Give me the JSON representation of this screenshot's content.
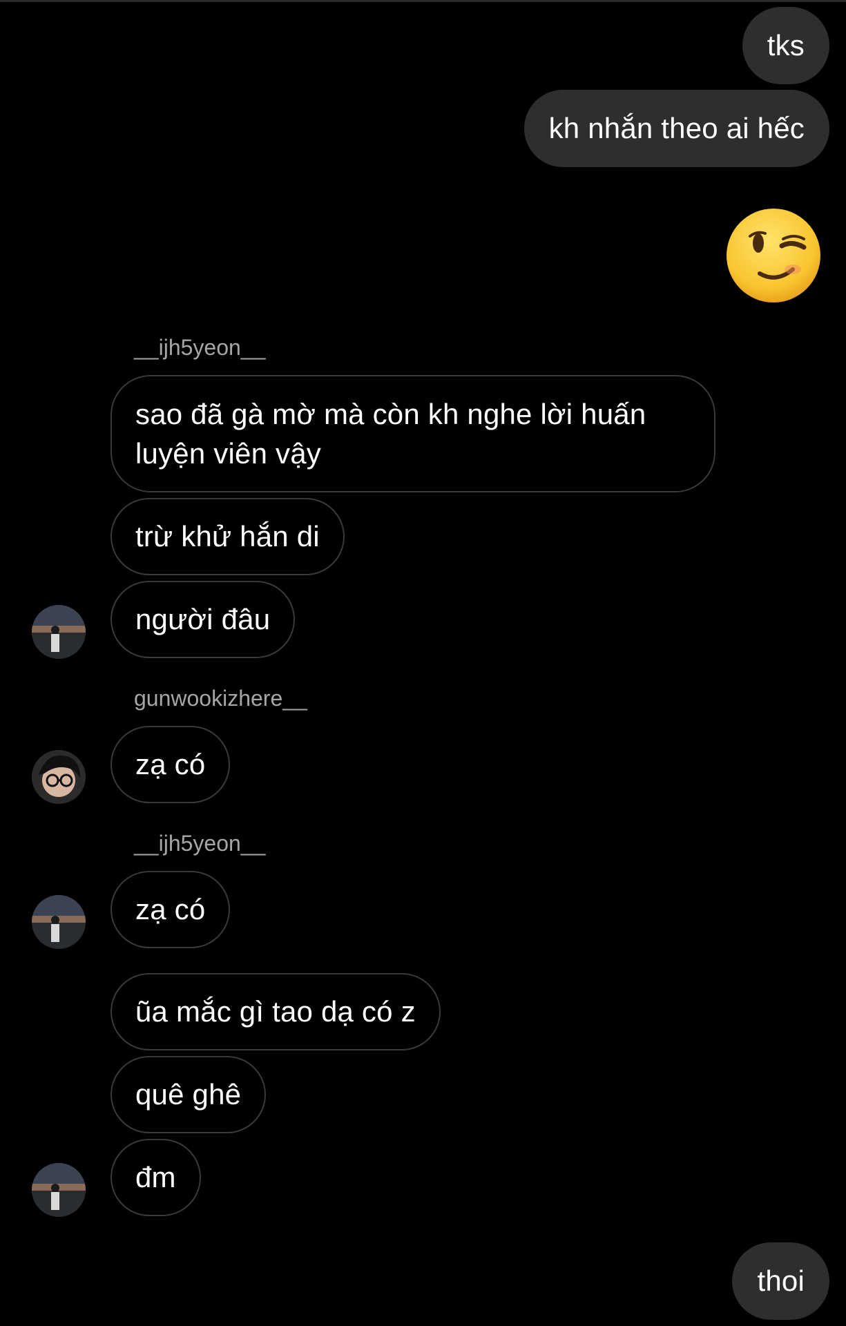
{
  "messages": {
    "m1": "tks",
    "m2": "kh nhắn theo ai hếc",
    "m3_emoji": "winking-face",
    "u1": "__ijh5yeon__",
    "m4": "sao đã gà mờ mà còn kh nghe lời huấn luyện viên vậy",
    "m5": "trừ khử hắn di",
    "m6": "người đâu",
    "u2": "gunwookizhere__",
    "m7": "zạ có",
    "u3": "__ijh5yeon__",
    "m8": "zạ có",
    "m9": "ũa mắc gì tao dạ có z",
    "m10": "quê ghê",
    "m11": "đm",
    "m12": "thoi"
  },
  "colors": {
    "background": "#000000",
    "my_bubble": "#2e2e2e",
    "their_bubble_border": "#3a3a3a",
    "username": "#a6a6a6",
    "text": "#ffffff"
  }
}
